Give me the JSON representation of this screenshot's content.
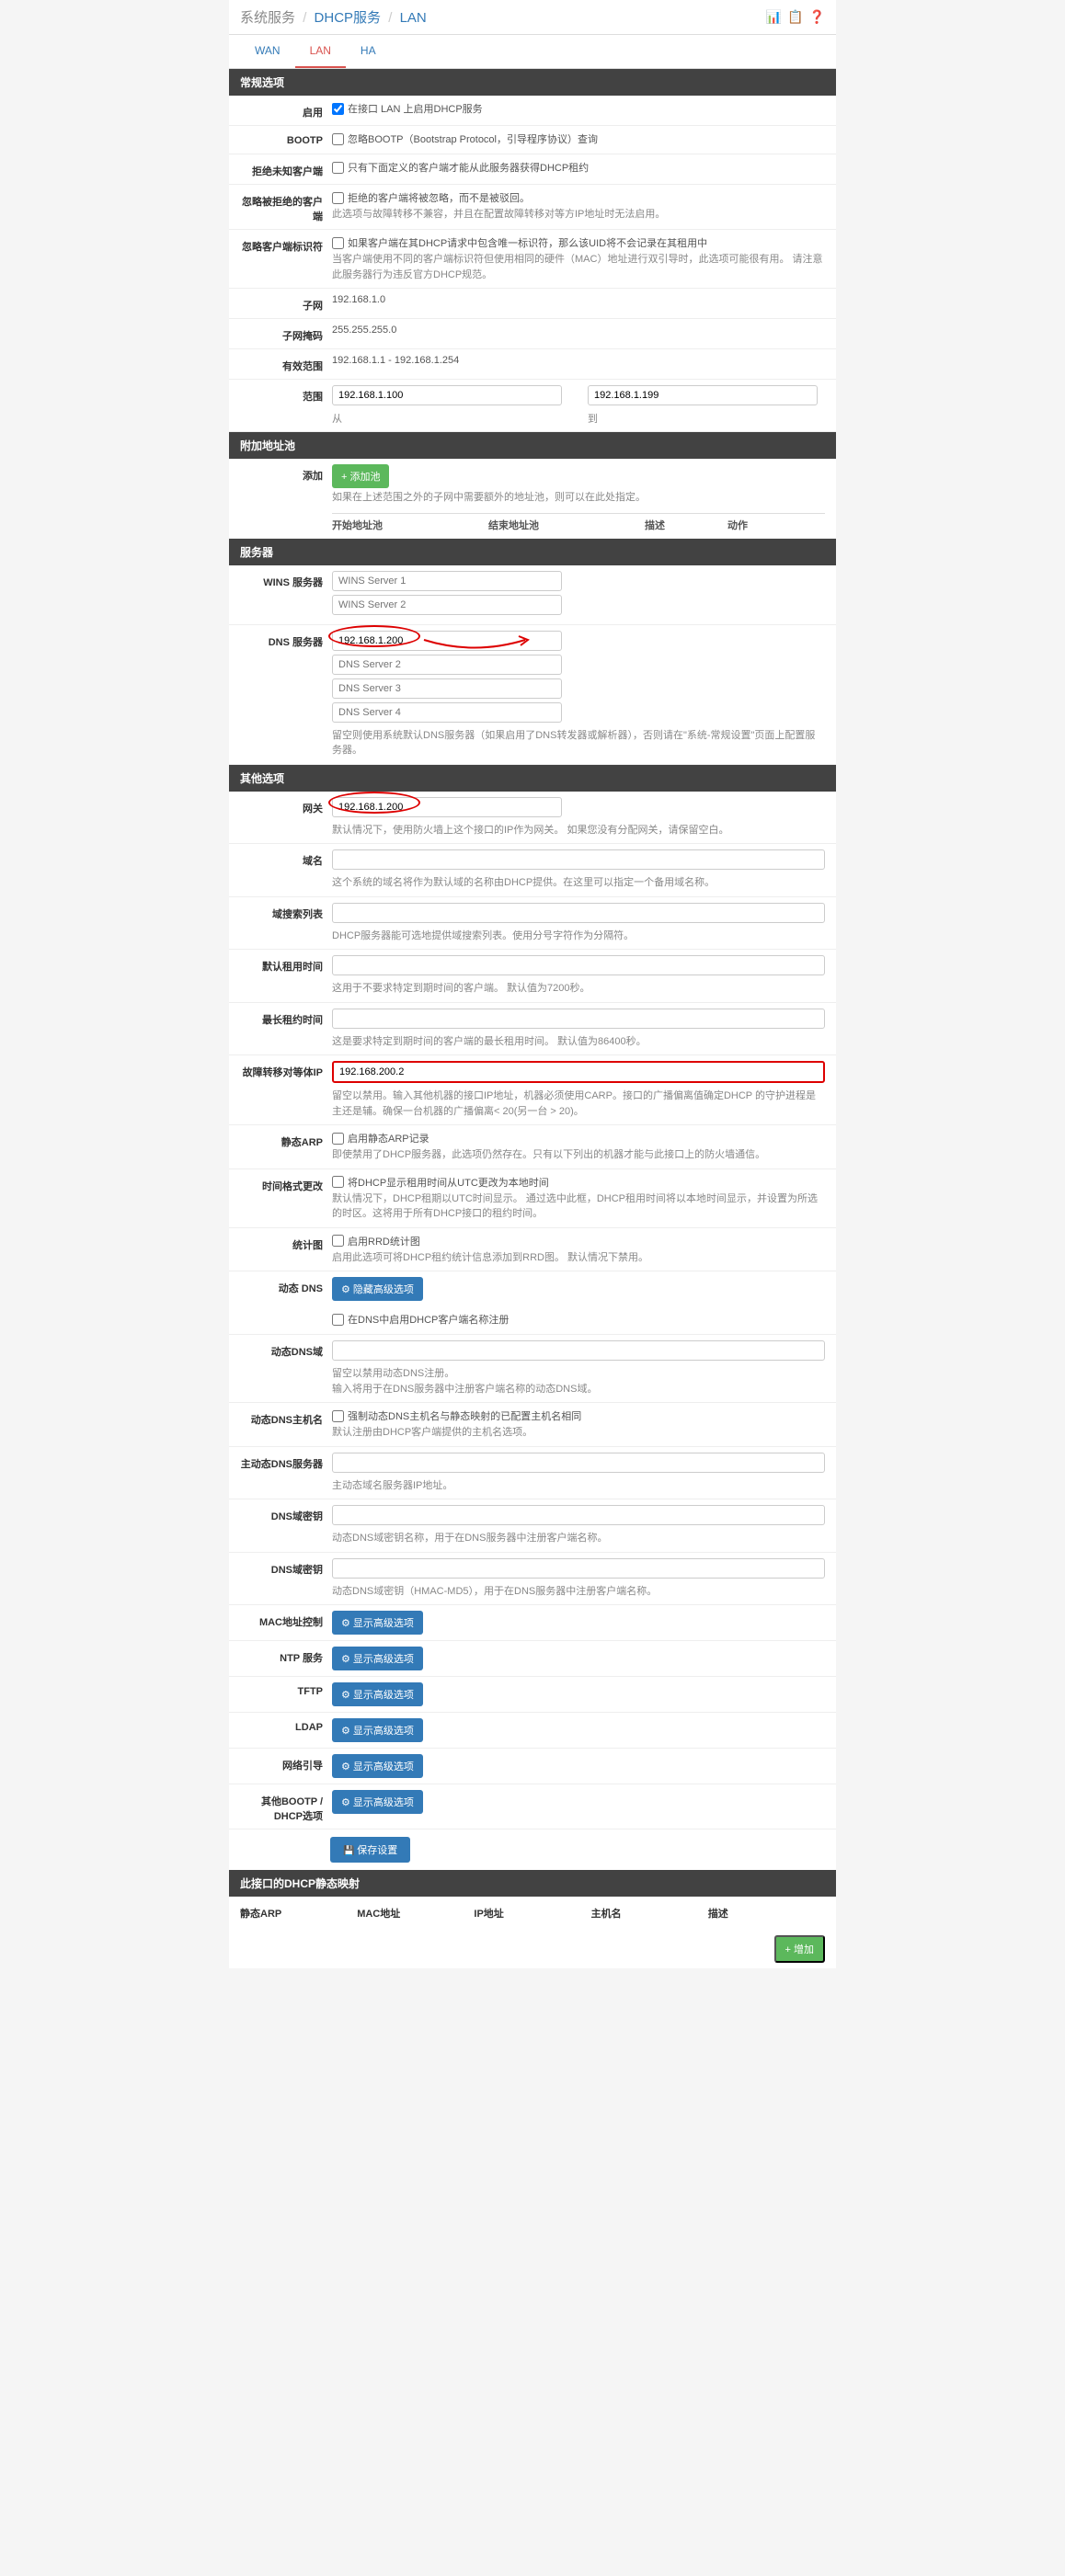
{
  "breadcrumb": {
    "root": "系统服务",
    "svc": "DHCP服务",
    "iface": "LAN"
  },
  "tabs": {
    "wan": "WAN",
    "lan": "LAN",
    "ha": "HA"
  },
  "sec": {
    "general": "常规选项",
    "pool": "附加地址池",
    "servers": "服务器",
    "other": "其他选项",
    "static": "此接口的DHCP静态映射"
  },
  "general": {
    "enable": {
      "lbl": "启用",
      "cb": "在接口 LAN 上启用DHCP服务"
    },
    "bootp": {
      "lbl": "BOOTP",
      "cb": "忽略BOOTP（Bootstrap Protocol，引导程序协议）查询"
    },
    "deny": {
      "lbl": "拒绝未知客户端",
      "cb": "只有下面定义的客户端才能从此服务器获得DHCP租约"
    },
    "ignore_denied": {
      "lbl": "忽略被拒绝的客户端",
      "cb": "拒绝的客户端将被忽略，而不是被驳回。",
      "help": "此选项与故障转移不兼容，并且在配置故障转移对等方IP地址时无法启用。"
    },
    "ignore_cid": {
      "lbl": "忽略客户端标识符",
      "cb": "如果客户端在其DHCP请求中包含唯一标识符，那么该UID将不会记录在其租用中",
      "help": "当客户端使用不同的客户端标识符但使用相同的硬件（MAC）地址进行双引导时，此选项可能很有用。 请注意此服务器行为违反官方DHCP规范。"
    },
    "subnet": {
      "lbl": "子网",
      "val": "192.168.1.0"
    },
    "mask": {
      "lbl": "子网掩码",
      "val": "255.255.255.0"
    },
    "avail": {
      "lbl": "有效范围",
      "val": "192.168.1.1 - 192.168.1.254"
    },
    "range": {
      "lbl": "范围",
      "from": "192.168.1.100",
      "to": "192.168.1.199",
      "from_lbl": "从",
      "to_lbl": "到"
    }
  },
  "pool": {
    "add": {
      "lbl": "添加",
      "btn": "添加池",
      "help": "如果在上述范围之外的子网中需要额外的地址池，则可以在此处指定。"
    },
    "cols": {
      "start": "开始地址池",
      "end": "结束地址池",
      "desc": "描述",
      "act": "动作"
    }
  },
  "servers": {
    "wins": {
      "lbl": "WINS 服务器",
      "p1": "WINS Server 1",
      "p2": "WINS Server 2"
    },
    "dns": {
      "lbl": "DNS 服务器",
      "v1": "192.168.1.200",
      "p2": "DNS Server 2",
      "p3": "DNS Server 3",
      "p4": "DNS Server 4",
      "help": "留空则使用系统默认DNS服务器（如果启用了DNS转发器或解析器），否则请在\"系统-常规设置\"页面上配置服务器。"
    }
  },
  "other": {
    "gateway": {
      "lbl": "网关",
      "val": "192.168.1.200",
      "help": "默认情况下，使用防火墙上这个接口的IP作为网关。 如果您没有分配网关，请保留空白。"
    },
    "domain": {
      "lbl": "域名",
      "help": "这个系统的域名将作为默认域的名称由DHCP提供。在这里可以指定一个备用域名称。"
    },
    "search": {
      "lbl": "域搜索列表",
      "help": "DHCP服务器能可选地提供域搜索列表。使用分号字符作为分隔符。"
    },
    "deflease": {
      "lbl": "默认租用时间",
      "help": "这用于不要求特定到期时间的客户端。 默认值为7200秒。"
    },
    "maxlease": {
      "lbl": "最长租约时间",
      "help": "这是要求特定到期时间的客户端的最长租用时间。 默认值为86400秒。"
    },
    "failover": {
      "lbl": "故障转移对等体IP",
      "val": "192.168.200.2",
      "help": "留空以禁用。输入其他机器的接口IP地址，机器必须使用CARP。接口的广播偏离值确定DHCP 的守护进程是主还是辅。确保一台机器的广播偏离< 20(另一台 > 20)。"
    },
    "staticarp": {
      "lbl": "静态ARP",
      "cb": "启用静态ARP记录",
      "help": "即使禁用了DHCP服务器，此选项仍然存在。只有以下列出的机器才能与此接口上的防火墙通信。"
    },
    "timefmt": {
      "lbl": "时间格式更改",
      "cb": "将DHCP显示租用时间从UTC更改为本地时间",
      "help": "默认情况下，DHCP租期以UTC时间显示。 通过选中此框，DHCP租用时间将以本地时间显示，并设置为所选的时区。这将用于所有DHCP接口的租约时间。"
    },
    "stats": {
      "lbl": "统计图",
      "cb": "启用RRD统计图",
      "help": "启用此选项可将DHCP租约统计信息添加到RRD图。 默认情况下禁用。"
    },
    "ddns": {
      "lbl": "动态 DNS",
      "btn": "隐藏高级选项",
      "cb": "在DNS中启用DHCP客户端名称注册"
    },
    "ddnsdom": {
      "lbl": "动态DNS域",
      "help": "留空以禁用动态DNS注册。\n输入将用于在DNS服务器中注册客户端名称的动态DNS域。"
    },
    "ddnshost": {
      "lbl": "动态DNS主机名",
      "cb": "强制动态DNS主机名与静态映射的已配置主机名相同",
      "help": "默认注册由DHCP客户端提供的主机名选项。"
    },
    "ddnssrv": {
      "lbl": "主动态DNS服务器",
      "help": "主动态域名服务器IP地址。"
    },
    "dnskey": {
      "lbl": "DNS域密钥",
      "help": "动态DNS域密钥名称，用于在DNS服务器中注册客户端名称。"
    },
    "dnssec": {
      "lbl": "DNS域密钥",
      "help": "动态DNS域密钥（HMAC-MD5），用于在DNS服务器中注册客户端名称。"
    },
    "mac": {
      "lbl": "MAC地址控制",
      "btn": "显示高级选项"
    },
    "ntp": {
      "lbl": "NTP 服务",
      "btn": "显示高级选项"
    },
    "tftp": {
      "lbl": "TFTP",
      "btn": "显示高级选项"
    },
    "ldap": {
      "lbl": "LDAP",
      "btn": "显示高级选项"
    },
    "netboot": {
      "lbl": "网络引导",
      "btn": "显示高级选项"
    },
    "bootp": {
      "lbl": "其他BOOTP / DHCP选项",
      "btn": "显示高级选项"
    }
  },
  "save": "保存设置",
  "static": {
    "arp": "静态ARP",
    "mac": "MAC地址",
    "ip": "IP地址",
    "host": "主机名",
    "desc": "描述"
  },
  "add_btn": "增加"
}
